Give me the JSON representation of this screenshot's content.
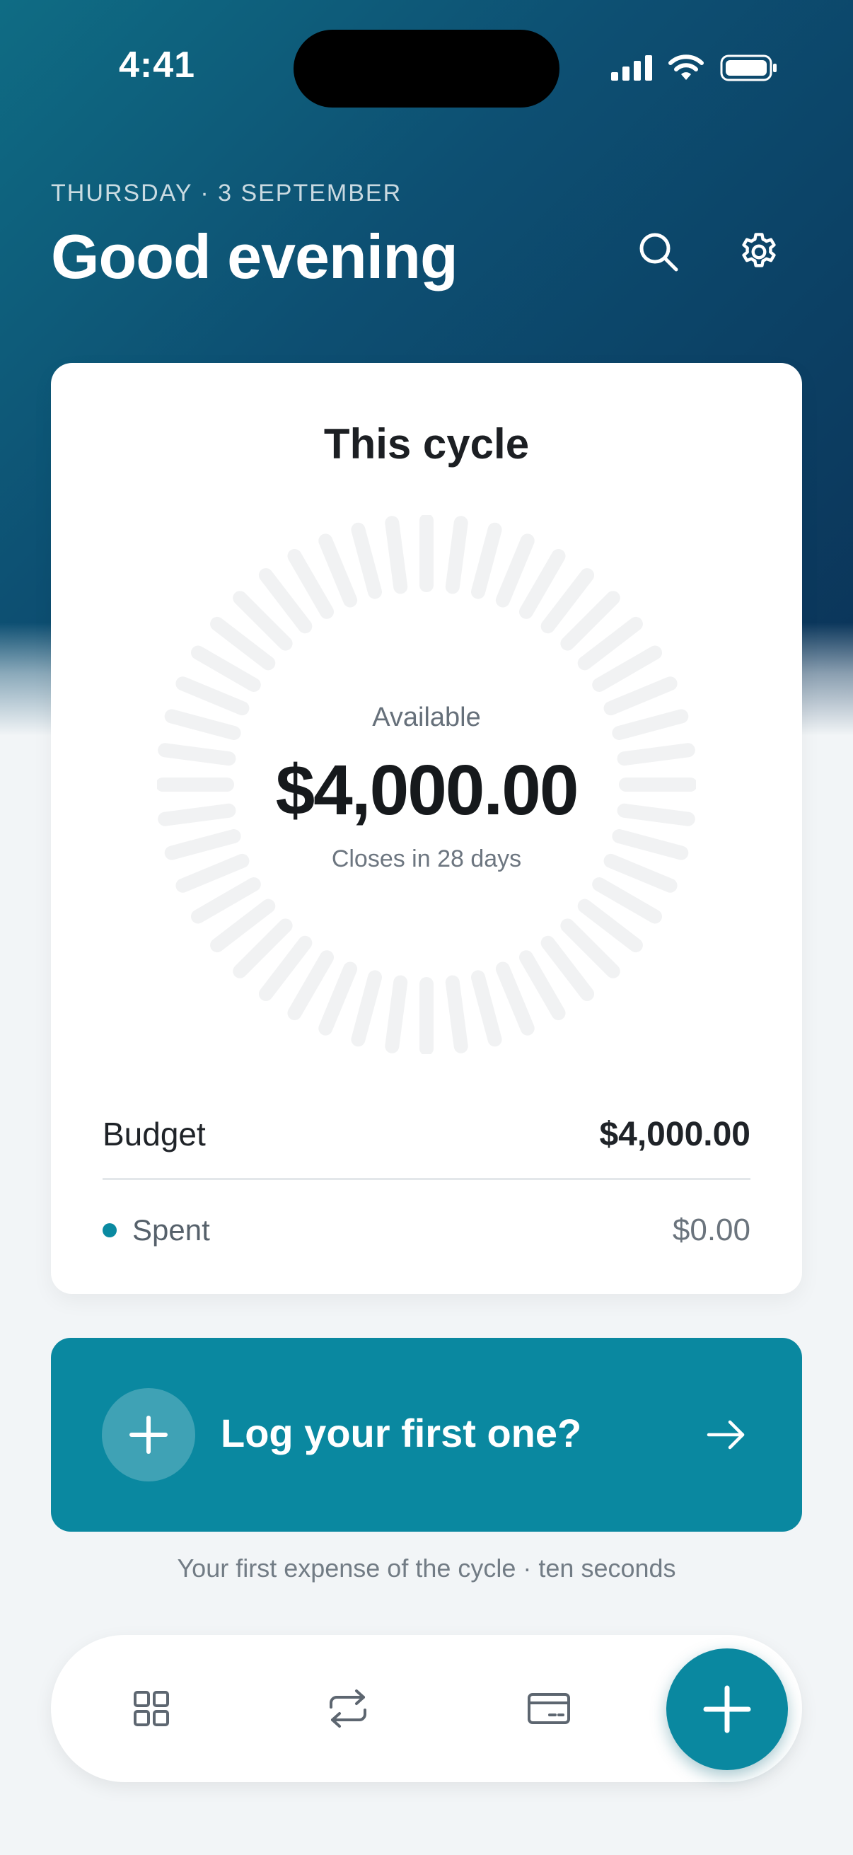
{
  "status_bar": {
    "time": "4:41"
  },
  "header": {
    "date": "THURSDAY · 3 SEPTEMBER",
    "greeting": "Good evening"
  },
  "cycle_card": {
    "title": "This cycle",
    "available_label": "Available",
    "available_amount": "$4,000.00",
    "closes_in": "Closes in 28 days",
    "spent_fraction": 0,
    "budget_label": "Budget",
    "budget_value": "$4,000.00",
    "spent_label": "Spent",
    "spent_value": "$0.00"
  },
  "cta": {
    "label": "Log your first one?",
    "subtitle": "Your first expense of the cycle · ten seconds"
  },
  "nav": {
    "items": [
      {
        "icon": "dashboard-grid-icon"
      },
      {
        "icon": "recurring-arrows-icon"
      },
      {
        "icon": "credit-card-icon"
      }
    ],
    "fab_icon": "plus-icon"
  },
  "colors": {
    "accent": "#0a88a0",
    "hero_start": "#0f6c84",
    "hero_end": "#0b3358",
    "ring_track": "#f1f2f3"
  }
}
